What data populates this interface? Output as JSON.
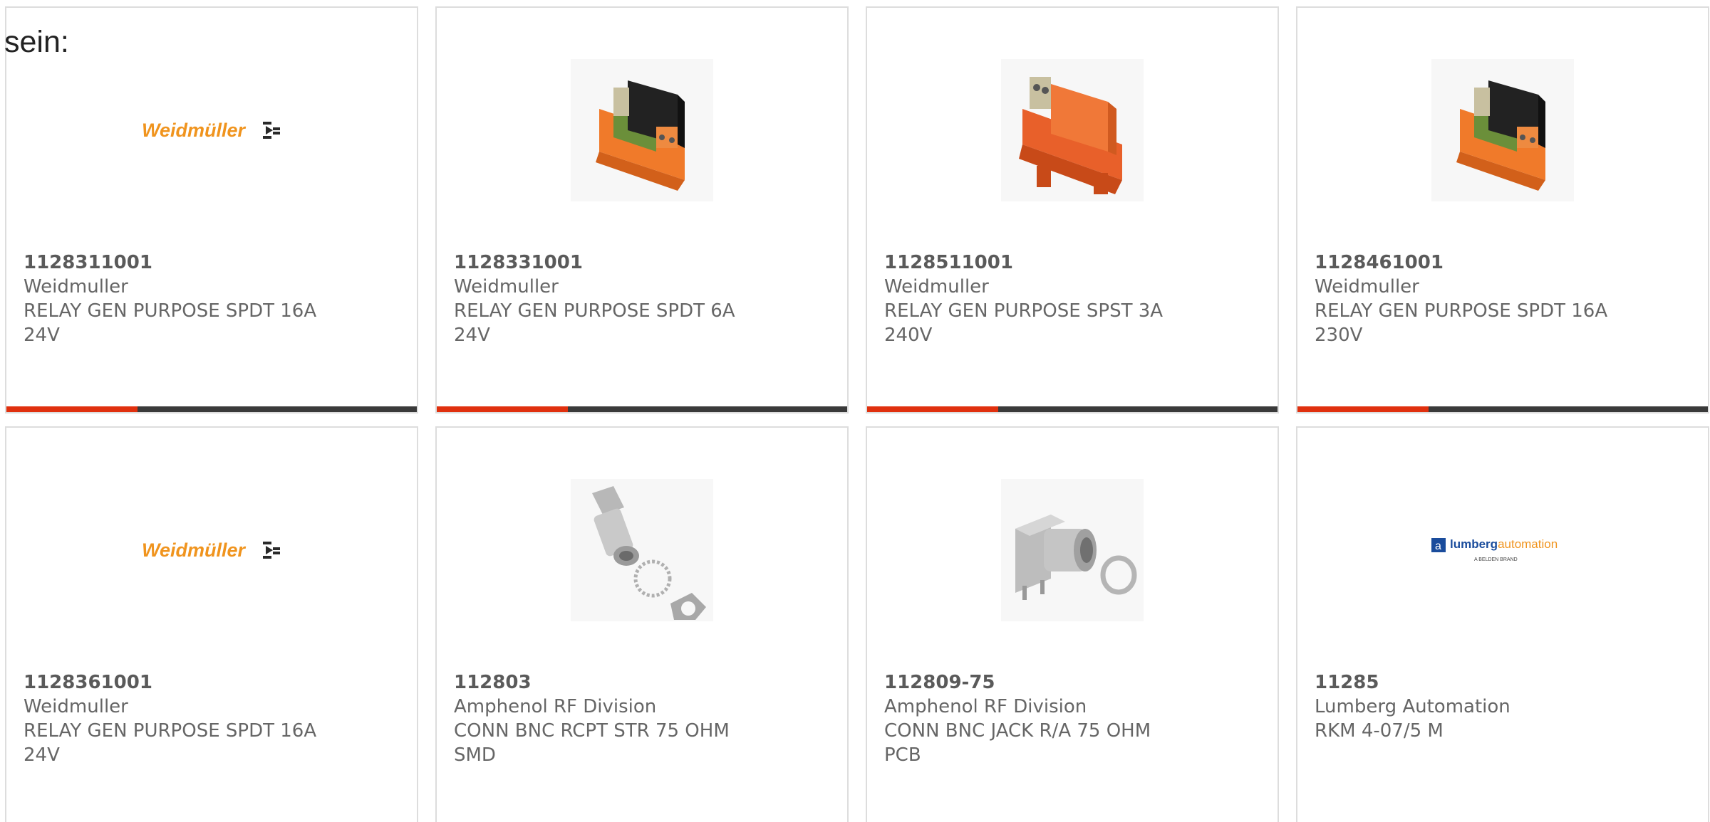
{
  "intro_text": "sein:",
  "colors": {
    "accent_bar": "#e0300e",
    "dark_bar": "#3a3a3a",
    "weidmuller_orange": "#f0941e",
    "lumberg_blue": "#1a4c9c"
  },
  "products": [
    {
      "part_number": "1128311001",
      "manufacturer": "Weidmuller",
      "description": "RELAY GEN PURPOSE SPDT 16A\n24V",
      "image": "weidmuller-logo",
      "logo_text": "Weidmüller"
    },
    {
      "part_number": "1128331001",
      "manufacturer": "Weidmuller",
      "description": "RELAY GEN PURPOSE SPDT 6A\n24V",
      "image": "relay-module-icon"
    },
    {
      "part_number": "1128511001",
      "manufacturer": "Weidmuller",
      "description": "RELAY GEN PURPOSE SPST 3A\n240V",
      "image": "relay-module-icon"
    },
    {
      "part_number": "1128461001",
      "manufacturer": "Weidmuller",
      "description": "RELAY GEN PURPOSE SPDT 16A\n230V",
      "image": "relay-module-icon"
    },
    {
      "part_number": "1128361001",
      "manufacturer": "Weidmuller",
      "description": "RELAY GEN PURPOSE SPDT 16A\n24V",
      "image": "weidmuller-logo",
      "logo_text": "Weidmüller"
    },
    {
      "part_number": "112803",
      "manufacturer": "Amphenol RF Division",
      "description": "CONN BNC RCPT STR 75 OHM\nSMD",
      "image": "bnc-receptacle-icon"
    },
    {
      "part_number": "112809-75",
      "manufacturer": "Amphenol RF Division",
      "description": "CONN BNC JACK R/A 75 OHM\nPCB",
      "image": "bnc-jack-icon"
    },
    {
      "part_number": "11285",
      "manufacturer": "Lumberg Automation",
      "description": "RKM 4-07/5 M",
      "image": "lumberg-logo",
      "logo_text": "lumbergautomation",
      "logo_subtext": "A BELDEN BRAND"
    }
  ]
}
